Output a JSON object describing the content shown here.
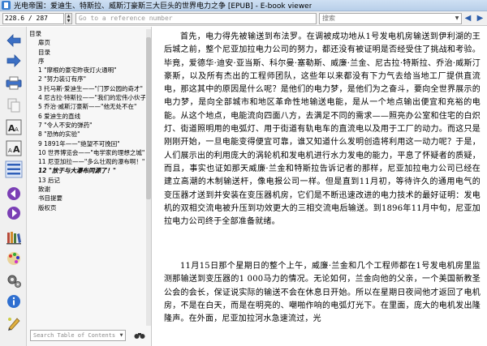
{
  "window": {
    "title": "光电帝国：爱迪生、特斯拉、威斯汀豪斯三大巨头的世界电力之争 [EPUB] - E-book viewer"
  },
  "navbar": {
    "position": "228.6 / 287",
    "reference_placeholder": "Go to a reference number",
    "search_placeholder": "搜索"
  },
  "toolbar": {
    "icons": [
      "back-arrow-icon",
      "forward-arrow-icon",
      "print-icon",
      "copy-icon",
      "font-larger-icon",
      "font-smaller-icon",
      "toc-icon",
      "previous-icon",
      "next-icon",
      "library-icon",
      "theme-icon",
      "settings-icon",
      "info-icon",
      "edit-icon"
    ]
  },
  "toc": {
    "heading": "目录",
    "items": [
      {
        "label": "扉页",
        "level": 1
      },
      {
        "label": "目录",
        "level": 1
      },
      {
        "label": "序",
        "level": 1
      },
      {
        "label": "1 \"摩根的豪宅昨夜灯火通明\"",
        "level": 1
      },
      {
        "label": "2 \"努力装订有序\"",
        "level": 1
      },
      {
        "label": "3 托马斯·爱迪生——\"门罗公园的奇才\"",
        "level": 1
      },
      {
        "label": "4 尼古拉·特斯拉——\"我们的宏伟小伙子\"",
        "level": 1
      },
      {
        "label": "5 乔治·威斯汀豪斯——\"他无处不在\"",
        "level": 1
      },
      {
        "label": "6 爱迪生的直线",
        "level": 1
      },
      {
        "label": "7 \"令人不安的弹药\"",
        "level": 1
      },
      {
        "label": "8 \"恐怖的实验\"",
        "level": 1
      },
      {
        "label": "9 1891年——\"绝望不可挽回\"",
        "level": 1
      },
      {
        "label": "10 世界博览会——\"电学家的理想之城\"",
        "level": 1
      },
      {
        "label": "11 尼亚加拉——\"多么壮观的瀑布啊！\"",
        "level": 1
      },
      {
        "label": "12 \"放于与大瀑布同源了！\"",
        "level": 1,
        "current": true
      },
      {
        "label": "13 后记",
        "level": 1
      },
      {
        "label": "致谢",
        "level": 1
      },
      {
        "label": "书目提要",
        "level": 1
      },
      {
        "label": "版权页",
        "level": 1
      }
    ],
    "search_placeholder": "Search Table of Contents"
  },
  "reader": {
    "paragraphs": [
      "首先，电力得先被输送到布法罗。在调被成功地从1号发电机房输送到伊利湖的王后城之前，整个尼亚加拉电力公司的努力，都还没有被证明是否经受住了挑战和考验。毕竟，爱德华·迪安·亚当斯、科尔曼·塞勒斯、威廉·兰金、尼古拉·特斯拉、乔治·威斯汀豪斯，以及所有杰出的工程师团队，这些年以来都没有下力气去给当地工厂提供直流电，那这其中的原因是什么呢？是他们的电力梦，是他们为之奋斗，要向全世界展示的电力梦，是向全部城市和地区革命性地输送电能，是从一个地点输出便宜和充裕的电能。从这个地点，电能流向四面八方，去满足不同的需求——照亮办公室和住宅的白炽灯、街道照明用的电弧灯、用于街道有轨电车的直流电以及用于工厂的动力。而这只是刚刚开始，一旦电能变得便宜可靠，谁又知道什么发明创造将利用这一动力呢？于是，人们展示出的利用庞大的涡轮机和发电机进行水力发电的能力，平息了怀疑者的质疑，而且，事实也证如那天威廉·兰金和特斯拉告诉记者的那样，尼亚加拉电力公司已经在建立高潮的木制输送杆，像电报公司一样。但是直到11月初，等待许久的通用电气的变压器才送到并安装在变压器机房，它们是不断迅速改进的电力技术的最好证明：发电机的双相交流电被升压到功效更大的三相交流电后输送。到1896年11月中旬，尼亚加拉电力公司终于全部准备就绪。",
      "11月15日那个星期日的整个上午，威廉·兰金和几个工程师都在1号发电机房里监测那输送到变压器的1 000马力的情况。无论如何，兰金向他的父亲，一个美国新教圣公会的会长，保证说实际的输送不会在休息日开始。所以在星期日夜间他才返回了电机房，不是在白天，而是在明亮的、嘲啪作响的电弧灯光下。在里面，庞大的电机发出隆隆声。在外面，尼亚加拉河水急速流过，光"
    ]
  }
}
